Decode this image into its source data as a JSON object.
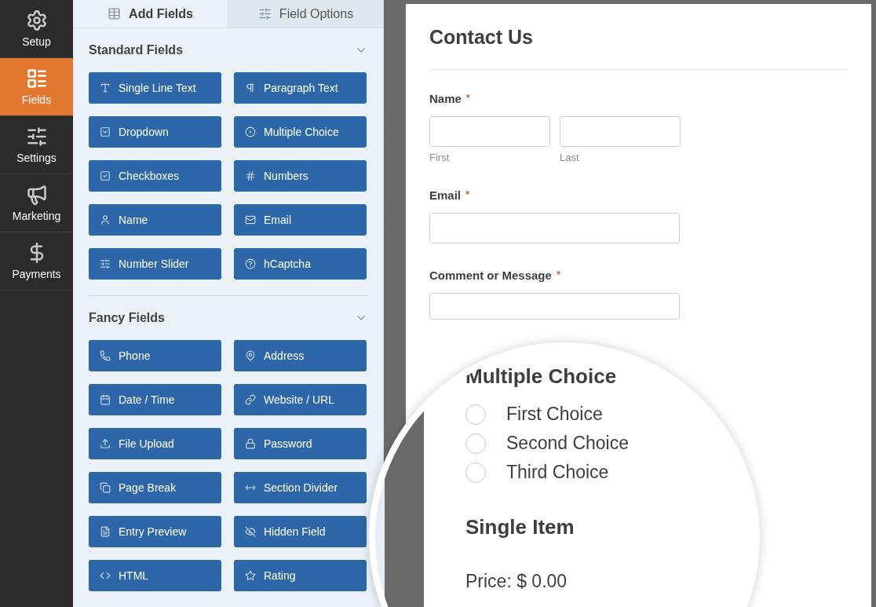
{
  "sidebar": {
    "items": [
      {
        "label": "Setup",
        "selected": false
      },
      {
        "label": "Fields",
        "selected": true
      },
      {
        "label": "Settings",
        "selected": false
      },
      {
        "label": "Marketing",
        "selected": false
      },
      {
        "label": "Payments",
        "selected": false
      }
    ]
  },
  "panel": {
    "tabs": [
      {
        "label": "Add Fields",
        "selected": true
      },
      {
        "label": "Field Options",
        "selected": false
      }
    ],
    "sections": [
      {
        "title": "Standard Fields",
        "expanded": true,
        "fields": [
          {
            "label": "Single Line Text"
          },
          {
            "label": "Paragraph Text"
          },
          {
            "label": "Dropdown"
          },
          {
            "label": "Multiple Choice"
          },
          {
            "label": "Checkboxes"
          },
          {
            "label": "Numbers"
          },
          {
            "label": "Name"
          },
          {
            "label": "Email"
          },
          {
            "label": "Number Slider"
          },
          {
            "label": "hCaptcha"
          }
        ]
      },
      {
        "title": "Fancy Fields",
        "expanded": true,
        "fields": [
          {
            "label": "Phone"
          },
          {
            "label": "Address"
          },
          {
            "label": "Date / Time"
          },
          {
            "label": "Website / URL"
          },
          {
            "label": "File Upload"
          },
          {
            "label": "Password"
          },
          {
            "label": "Page Break"
          },
          {
            "label": "Section Divider"
          },
          {
            "label": "Entry Preview"
          },
          {
            "label": "Hidden Field"
          },
          {
            "label": "HTML"
          },
          {
            "label": "Rating"
          }
        ]
      }
    ]
  },
  "form": {
    "title": "Contact Us",
    "fields": [
      {
        "kind": "name",
        "label": "Name",
        "required_mark": "*",
        "sublabels": [
          "First",
          "Last"
        ]
      },
      {
        "kind": "email",
        "label": "Email",
        "required_mark": "*"
      },
      {
        "kind": "textarea",
        "label": "Comment or Message",
        "required_mark": "*"
      }
    ]
  },
  "magnifier": {
    "multiple_choice": {
      "title": "Multiple Choice",
      "choices": [
        {
          "label": "First Choice",
          "selected": false
        },
        {
          "label": "Second Choice",
          "selected": false
        },
        {
          "label": "Third Choice",
          "selected": false
        }
      ]
    },
    "single_item": {
      "title": "Single Item",
      "price": "Price: $ 0.00"
    }
  }
}
